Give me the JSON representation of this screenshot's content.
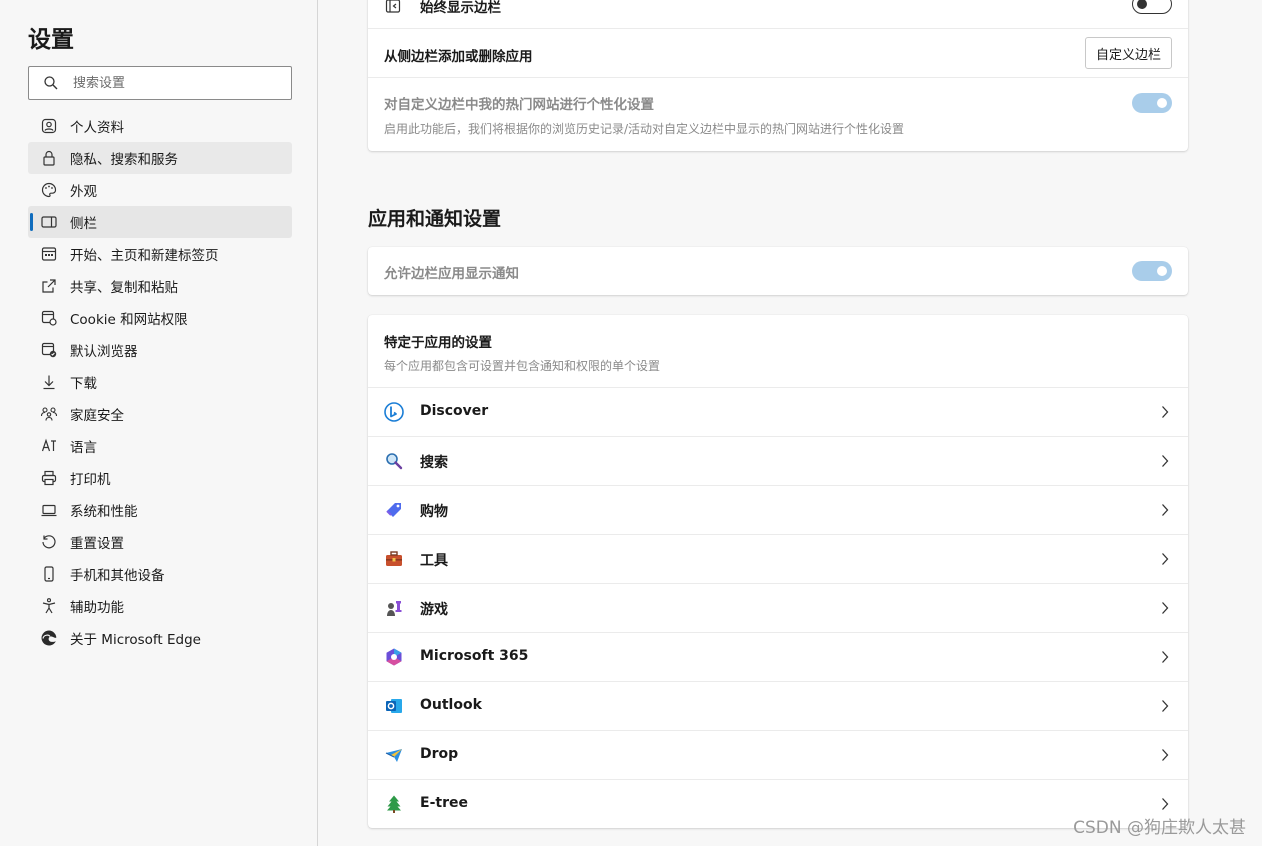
{
  "sidebar": {
    "title": "设置",
    "search_placeholder": "搜索设置",
    "items": [
      {
        "label": "个人资料",
        "icon": "profile-icon"
      },
      {
        "label": "隐私、搜索和服务",
        "icon": "lock-icon"
      },
      {
        "label": "外观",
        "icon": "palette-icon"
      },
      {
        "label": "侧栏",
        "icon": "sidebar-icon"
      },
      {
        "label": "开始、主页和新建标签页",
        "icon": "home-icon"
      },
      {
        "label": "共享、复制和粘贴",
        "icon": "share-icon"
      },
      {
        "label": "Cookie 和网站权限",
        "icon": "cookie-icon"
      },
      {
        "label": "默认浏览器",
        "icon": "browser-icon"
      },
      {
        "label": "下载",
        "icon": "download-icon"
      },
      {
        "label": "家庭安全",
        "icon": "family-icon"
      },
      {
        "label": "语言",
        "icon": "language-icon"
      },
      {
        "label": "打印机",
        "icon": "printer-icon"
      },
      {
        "label": "系统和性能",
        "icon": "system-icon"
      },
      {
        "label": "重置设置",
        "icon": "reset-icon"
      },
      {
        "label": "手机和其他设备",
        "icon": "phone-icon"
      },
      {
        "label": "辅助功能",
        "icon": "accessibility-icon"
      },
      {
        "label": "关于 Microsoft Edge",
        "icon": "edge-logo-icon"
      }
    ]
  },
  "top_card": {
    "always_show_label": "始终显示边栏",
    "add_remove_label": "从侧边栏添加或删除应用",
    "customize_button": "自定义边栏",
    "personalize_label": "对自定义边栏中我的热门网站进行个性化设置",
    "personalize_desc": "启用此功能后，我们将根据你的浏览历史记录/活动对自定义边栏中显示的热门网站进行个性化设置"
  },
  "section": {
    "title": "应用和通知设置",
    "allow_notifications_label": "允许边栏应用显示通知"
  },
  "apps_card": {
    "title": "特定于应用的设置",
    "desc": "每个应用都包含可设置并包含通知和权限的单个设置",
    "apps": [
      {
        "name": "Discover",
        "icon": "bing-icon"
      },
      {
        "name": "搜索",
        "icon": "magnifier-icon"
      },
      {
        "name": "购物",
        "icon": "shopping-tag-icon"
      },
      {
        "name": "工具",
        "icon": "toolbox-icon"
      },
      {
        "name": "游戏",
        "icon": "chess-icon"
      },
      {
        "name": "Microsoft 365",
        "icon": "m365-icon"
      },
      {
        "name": "Outlook",
        "icon": "outlook-icon"
      },
      {
        "name": "Drop",
        "icon": "paper-plane-icon"
      },
      {
        "name": "E-tree",
        "icon": "tree-icon"
      }
    ]
  },
  "watermark": "CSDN @狗庄欺人太甚",
  "colors": {
    "accent": "#0f6cbd",
    "toggle_on_dim": "#a9cdea",
    "page_bg": "#f7f7f7"
  }
}
